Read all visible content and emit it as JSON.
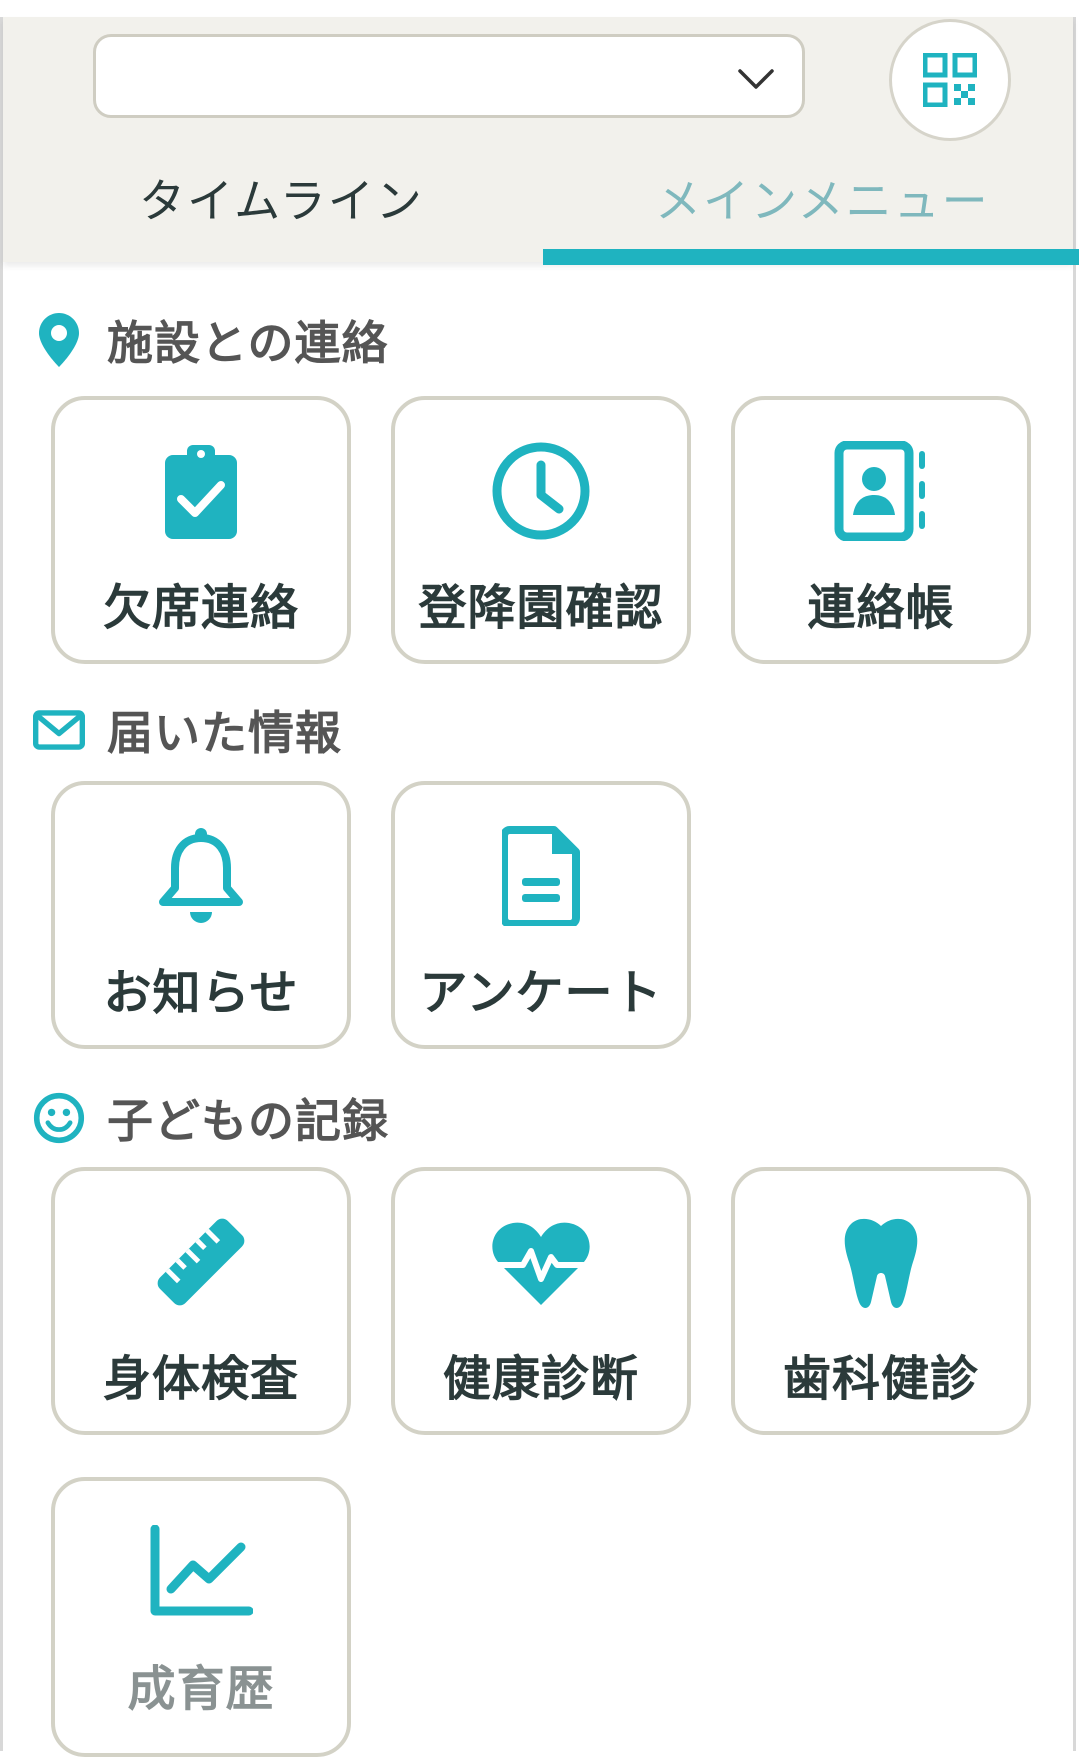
{
  "header": {
    "select_value": "",
    "qr_icon": "qr-code-icon",
    "chevron_icon": "chevron-down-icon"
  },
  "tabs": [
    {
      "label": "タイムライン",
      "active": false
    },
    {
      "label": "メインメニュー",
      "active": true
    }
  ],
  "colors": {
    "accent": "#1fb3c0",
    "tile_border": "#d3d2c6",
    "header_bg": "#f2f1ec"
  },
  "sections": [
    {
      "title": "施設との連絡",
      "icon": "map-pin-icon",
      "items": [
        {
          "label": "欠席連絡",
          "icon": "clipboard-check-icon"
        },
        {
          "label": "登降園確認",
          "icon": "clock-icon"
        },
        {
          "label": "連絡帳",
          "icon": "contact-book-icon"
        }
      ]
    },
    {
      "title": "届いた情報",
      "icon": "envelope-icon",
      "items": [
        {
          "label": "お知らせ",
          "icon": "bell-icon"
        },
        {
          "label": "アンケート",
          "icon": "document-icon"
        }
      ]
    },
    {
      "title": "子どもの記録",
      "icon": "smile-icon",
      "items": [
        {
          "label": "身体検査",
          "icon": "ruler-icon"
        },
        {
          "label": "健康診断",
          "icon": "heartbeat-icon"
        },
        {
          "label": "歯科健診",
          "icon": "tooth-icon"
        },
        {
          "label": "成育歴",
          "icon": "line-chart-icon"
        }
      ]
    }
  ]
}
